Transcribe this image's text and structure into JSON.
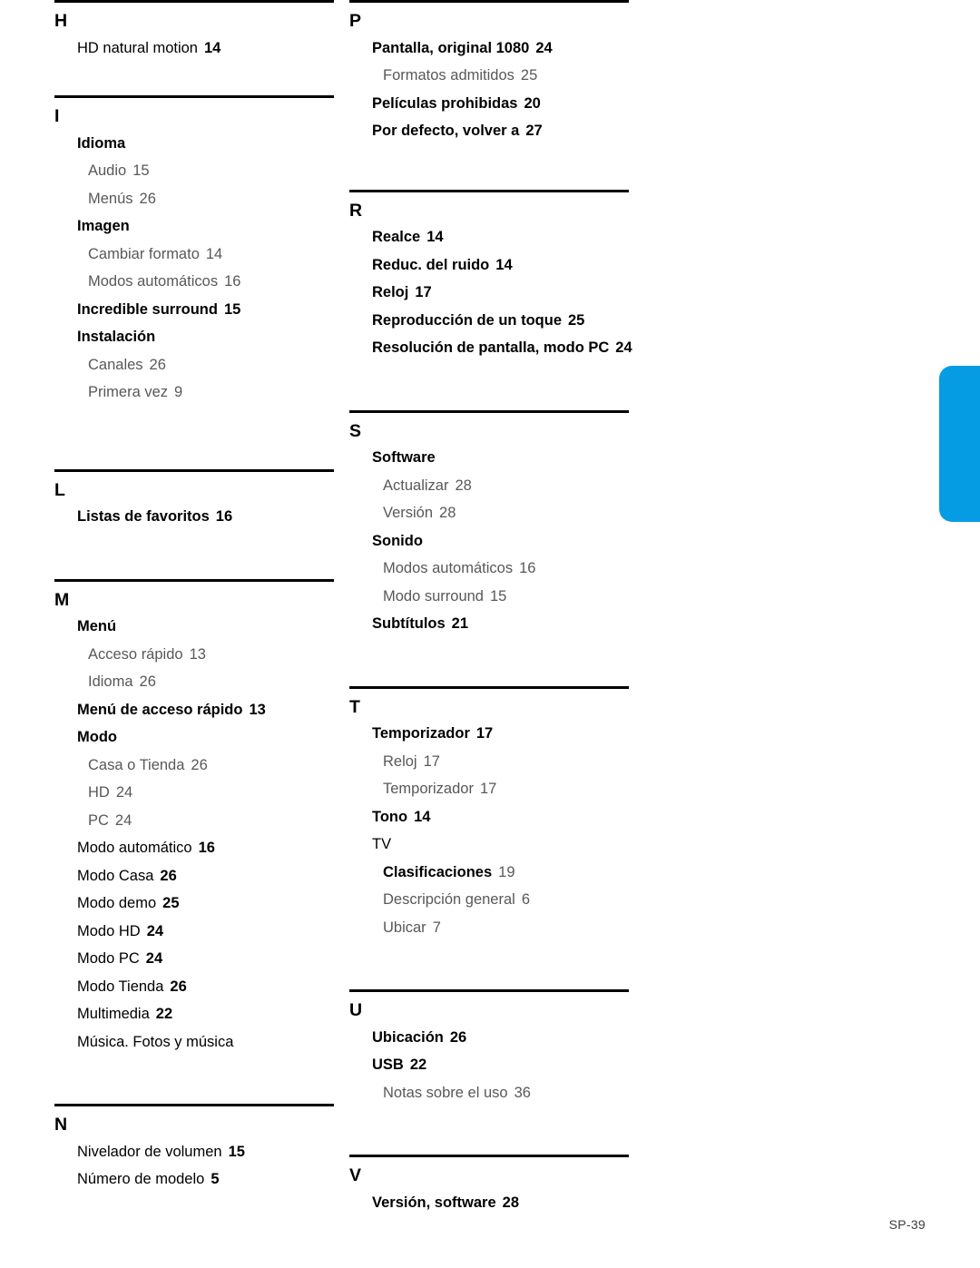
{
  "document": {
    "type": "index",
    "footer_page_label": "SP-39",
    "accent_color": "#069ce4",
    "body_text_color": "#000000",
    "subentry_text_color": "#58585a"
  },
  "columns": [
    {
      "name": "left-column",
      "sections": [
        {
          "letter": "H",
          "entries": [
            {
              "level": 1,
              "weight": "regular",
              "label": "HD natural motion",
              "page": "14"
            }
          ]
        },
        {
          "letter": "I",
          "entries": [
            {
              "level": 1,
              "weight": "bold",
              "label": "Idioma",
              "page": ""
            },
            {
              "level": 2,
              "weight": "regular",
              "label": "Audio",
              "page": "15"
            },
            {
              "level": 2,
              "weight": "regular",
              "label": "Menús",
              "page": "26"
            },
            {
              "level": 1,
              "weight": "bold",
              "label": "Imagen",
              "page": ""
            },
            {
              "level": 2,
              "weight": "regular",
              "label": "Cambiar formato",
              "page": "14"
            },
            {
              "level": 2,
              "weight": "regular",
              "label": "Modos automáticos",
              "page": "16"
            },
            {
              "level": 1,
              "weight": "bold",
              "label": "Incredible surround",
              "page": "15"
            },
            {
              "level": 1,
              "weight": "bold",
              "label": "Instalación",
              "page": ""
            },
            {
              "level": 2,
              "weight": "regular",
              "label": "Canales",
              "page": "26"
            },
            {
              "level": 2,
              "weight": "regular",
              "label": "Primera vez",
              "page": "9"
            }
          ]
        },
        {
          "letter": "L",
          "entries": [
            {
              "level": 1,
              "weight": "bold",
              "label": "Listas de favoritos",
              "page": "16"
            }
          ]
        },
        {
          "letter": "M",
          "entries": [
            {
              "level": 1,
              "weight": "bold",
              "label": "Menú",
              "page": ""
            },
            {
              "level": 2,
              "weight": "regular",
              "label": "Acceso rápido",
              "page": "13"
            },
            {
              "level": 2,
              "weight": "regular",
              "label": "Idioma",
              "page": "26"
            },
            {
              "level": 1,
              "weight": "bold",
              "label": "Menú de acceso rápido",
              "page": "13"
            },
            {
              "level": 1,
              "weight": "bold",
              "label": "Modo",
              "page": ""
            },
            {
              "level": 2,
              "weight": "regular",
              "label": "Casa o Tienda",
              "page": "26"
            },
            {
              "level": 2,
              "weight": "regular",
              "label": "HD",
              "page": "24"
            },
            {
              "level": 2,
              "weight": "regular",
              "label": "PC",
              "page": "24"
            },
            {
              "level": 1,
              "weight": "regular",
              "label": "Modo automático",
              "page": "16"
            },
            {
              "level": 1,
              "weight": "regular",
              "label": "Modo Casa",
              "page": "26"
            },
            {
              "level": 1,
              "weight": "regular",
              "label": "Modo demo",
              "page": "25"
            },
            {
              "level": 1,
              "weight": "regular",
              "label": "Modo HD",
              "page": "24"
            },
            {
              "level": 1,
              "weight": "regular",
              "label": "Modo PC",
              "page": "24"
            },
            {
              "level": 1,
              "weight": "regular",
              "label": "Modo Tienda",
              "page": "26"
            },
            {
              "level": 1,
              "weight": "regular",
              "label": "Multimedia",
              "page": "22"
            },
            {
              "level": 1,
              "weight": "regular",
              "label": "Música. Fotos y música",
              "page": ""
            }
          ]
        },
        {
          "letter": "N",
          "entries": [
            {
              "level": 1,
              "weight": "regular",
              "label": "Nivelador de volumen",
              "page": "15"
            },
            {
              "level": 1,
              "weight": "regular",
              "label": "Número de modelo",
              "page": "5"
            }
          ]
        }
      ]
    },
    {
      "name": "right-column",
      "sections": [
        {
          "letter": "P",
          "entries": [
            {
              "level": 1,
              "weight": "bold",
              "label": "Pantalla, original 1080",
              "page": "24"
            },
            {
              "level": 2,
              "weight": "regular",
              "label": "Formatos admitidos",
              "page": "25"
            },
            {
              "level": 1,
              "weight": "bold",
              "label": "Películas prohibidas",
              "page": "20"
            },
            {
              "level": 1,
              "weight": "bold",
              "label": "Por defecto, volver a",
              "page": "27"
            }
          ]
        },
        {
          "letter": "R",
          "entries": [
            {
              "level": 1,
              "weight": "bold",
              "label": "Realce",
              "page": "14"
            },
            {
              "level": 1,
              "weight": "bold",
              "label": "Reduc. del ruido",
              "page": "14"
            },
            {
              "level": 1,
              "weight": "bold",
              "label": "Reloj",
              "page": "17"
            },
            {
              "level": 1,
              "weight": "bold",
              "label": "Reproducción de un toque",
              "page": "25"
            },
            {
              "level": 1,
              "weight": "bold",
              "label": "Resolución de pantalla, modo PC",
              "page": "24"
            }
          ]
        },
        {
          "letter": "S",
          "entries": [
            {
              "level": 1,
              "weight": "bold",
              "label": "Software",
              "page": ""
            },
            {
              "level": 2,
              "weight": "regular",
              "label": "Actualizar",
              "page": "28"
            },
            {
              "level": 2,
              "weight": "regular",
              "label": "Versión",
              "page": "28"
            },
            {
              "level": 1,
              "weight": "bold",
              "label": "Sonido",
              "page": ""
            },
            {
              "level": 2,
              "weight": "regular",
              "label": "Modos automáticos",
              "page": "16"
            },
            {
              "level": 2,
              "weight": "regular",
              "label": "Modo surround",
              "page": "15"
            },
            {
              "level": 1,
              "weight": "bold",
              "label": "Subtítulos",
              "page": "21"
            }
          ]
        },
        {
          "letter": "T",
          "entries": [
            {
              "level": 1,
              "weight": "bold",
              "label": "Temporizador",
              "page": "17"
            },
            {
              "level": 2,
              "weight": "regular",
              "label": "Reloj",
              "page": "17"
            },
            {
              "level": 2,
              "weight": "regular",
              "label": "Temporizador",
              "page": "17"
            },
            {
              "level": 1,
              "weight": "bold",
              "label": "Tono",
              "page": "14"
            },
            {
              "level": 1,
              "weight": "regular",
              "label": "TV",
              "page": ""
            },
            {
              "level": 2,
              "weight": "bold",
              "label": "Clasificaciones",
              "page": "19"
            },
            {
              "level": 2,
              "weight": "regular",
              "label": "Descripción general",
              "page": "6"
            },
            {
              "level": 2,
              "weight": "regular",
              "label": "Ubicar",
              "page": "7"
            }
          ]
        },
        {
          "letter": "U",
          "entries": [
            {
              "level": 1,
              "weight": "bold",
              "label": "Ubicación",
              "page": "26"
            },
            {
              "level": 1,
              "weight": "bold",
              "label": "USB",
              "page": "22"
            },
            {
              "level": 2,
              "weight": "regular",
              "label": "Notas sobre el uso",
              "page": "36"
            }
          ]
        },
        {
          "letter": "V",
          "entries": [
            {
              "level": 1,
              "weight": "bold",
              "label": "Versión, software",
              "page": "28"
            }
          ]
        }
      ]
    }
  ]
}
